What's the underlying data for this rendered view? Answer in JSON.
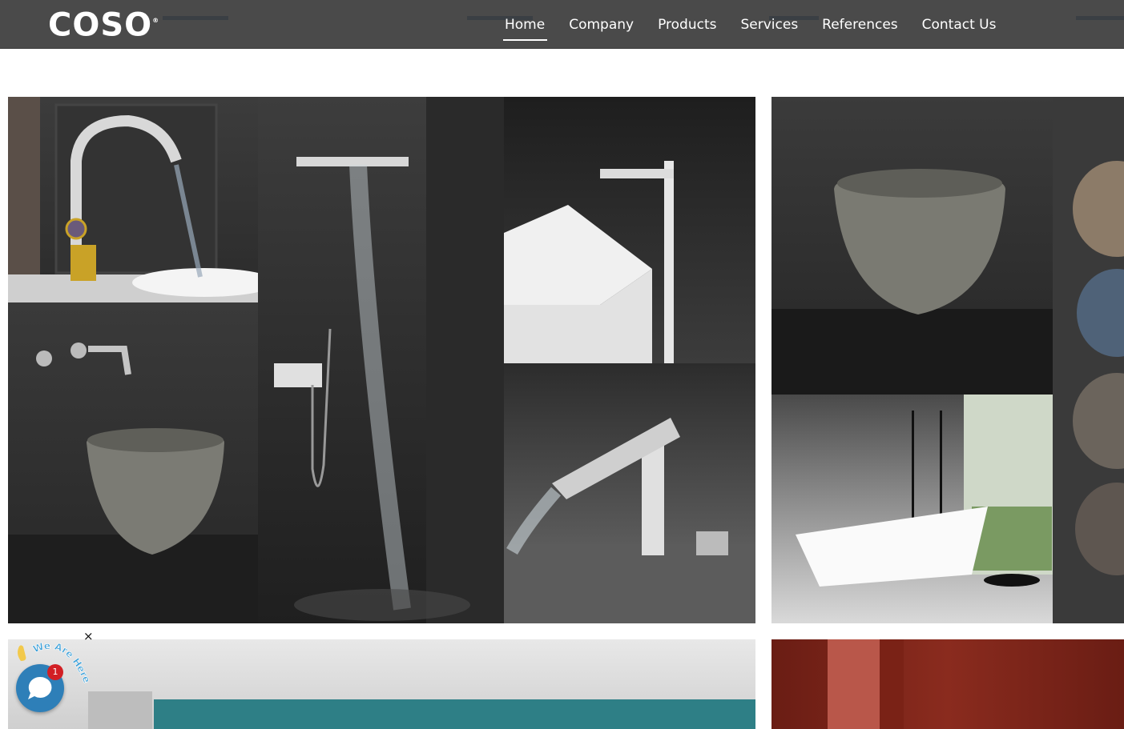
{
  "header": {
    "logo_text": "COSO",
    "logo_mark": "®",
    "nav": [
      {
        "label": "Home",
        "active": true
      },
      {
        "label": "Company",
        "active": false
      },
      {
        "label": "Products",
        "active": false
      },
      {
        "label": "Services",
        "active": false
      },
      {
        "label": "References",
        "active": false
      },
      {
        "label": "Contact Us",
        "active": false
      }
    ]
  },
  "chat": {
    "label": "We Are Here!",
    "badge": "1",
    "close": "×",
    "wave_icon": "waving-hand-icon",
    "chat_icon": "chat-bubble-icon"
  },
  "colors": {
    "header_bg": "#4a4a4a",
    "accent": "#2e7fb8",
    "badge": "#d21f24"
  }
}
